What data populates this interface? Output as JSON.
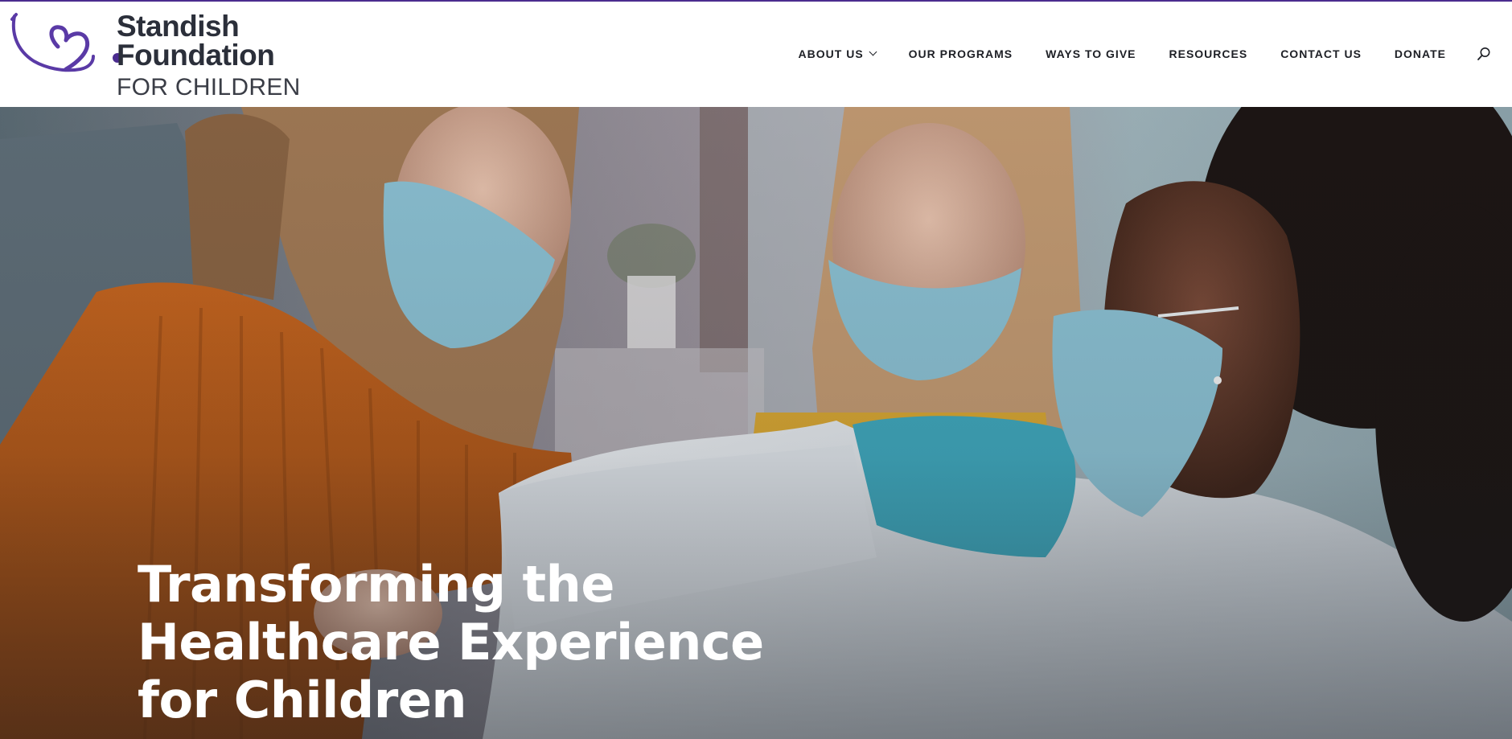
{
  "colors": {
    "accent": "#4b2c8f",
    "logo_text": "#2b2f3a",
    "nav_text": "#1d1f25",
    "hero_title": "#ffffff"
  },
  "logo": {
    "line1": "Standish",
    "line2": "Foundation",
    "line3": "FOR CHILDREN",
    "icon": "stethoscope-heart-icon"
  },
  "nav": {
    "items": [
      {
        "label": "ABOUT US",
        "has_dropdown": true
      },
      {
        "label": "OUR PROGRAMS"
      },
      {
        "label": "WAYS TO GIVE"
      },
      {
        "label": "RESOURCES"
      },
      {
        "label": "CONTACT US"
      },
      {
        "label": "DONATE"
      }
    ],
    "search_icon": "search-icon"
  },
  "hero": {
    "title_lines": [
      "Transforming the",
      "Healthcare Experience",
      "for Children"
    ]
  }
}
